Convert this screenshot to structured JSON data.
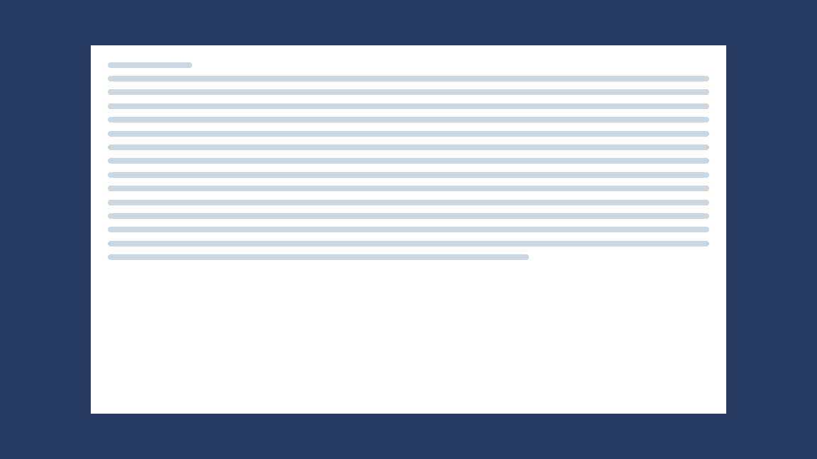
{
  "theme": {
    "background": "#263a60",
    "card": "#ffffff",
    "placeholder": "#ccd8e1"
  },
  "loading_card": {
    "state": "loading",
    "title_placeholder_fraction": 0.14,
    "line_placeholder_fractions": [
      1,
      1,
      1,
      1,
      1,
      1,
      1,
      1,
      1,
      1,
      1,
      1,
      1,
      0.7
    ]
  }
}
